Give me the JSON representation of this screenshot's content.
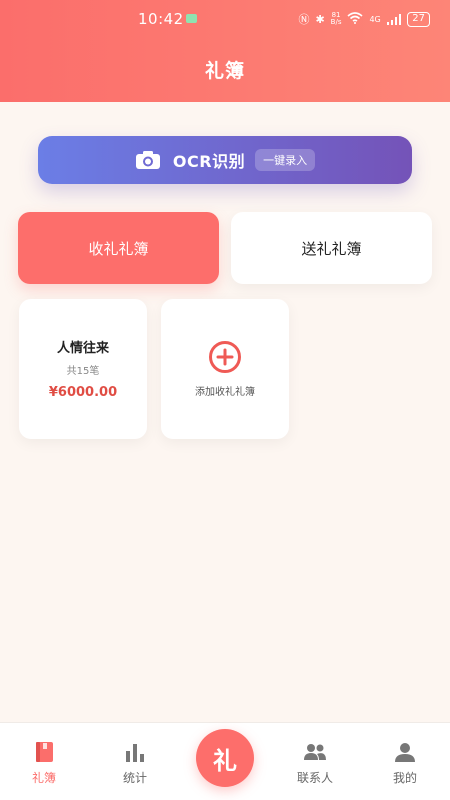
{
  "status_bar": {
    "time": "10:42",
    "network_speed_value": "81",
    "network_speed_unit": "B/s",
    "network_type": "4G",
    "battery": "27"
  },
  "header": {
    "title": "礼簿"
  },
  "ocr": {
    "label": "OCR识别",
    "badge": "一键录入"
  },
  "tabs": [
    {
      "label": "收礼礼簿",
      "active": true
    },
    {
      "label": "送礼礼簿",
      "active": false
    }
  ],
  "books": [
    {
      "name": "人情往来",
      "count": "共15笔",
      "amount": "¥6000.00"
    }
  ],
  "add_book": {
    "label": "添加收礼礼簿"
  },
  "nav": {
    "items": [
      {
        "label": "礼簿",
        "icon": "book-icon",
        "active": true
      },
      {
        "label": "统计",
        "icon": "bar-chart-icon",
        "active": false
      },
      {
        "label": "联系人",
        "icon": "contacts-icon",
        "active": false
      },
      {
        "label": "我的",
        "icon": "person-icon",
        "active": false
      }
    ],
    "center_label": "礼"
  },
  "colors": {
    "primary": "#fd6e6b",
    "ocr_start": "#6b7ee6",
    "ocr_end": "#7453b8",
    "amount": "#e04d44"
  }
}
